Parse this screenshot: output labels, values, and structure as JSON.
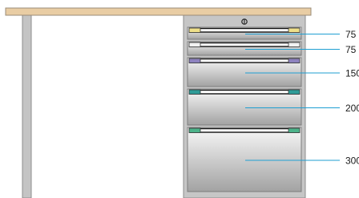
{
  "colors": {
    "worktop": "#e9cda4",
    "worktop_edge": "#9a8c78",
    "leg": "#c4c4c4",
    "leg_edge": "#8e8e8e",
    "cabinet": "#c6c6c6",
    "cabinet_edge": "#8c8c8c",
    "drawer_light": "#f8f8f8",
    "drawer_dark": "#a2a2a2",
    "leader_line": "#1f9fd2",
    "lock": "#222222"
  },
  "lock_icon": "lock-keyhole-icon",
  "drawers": [
    {
      "height_label": "75",
      "clip_color": "#efe08a",
      "clip_icon": "label-clip-icon"
    },
    {
      "height_label": "75",
      "clip_color": "#f2f2f2",
      "clip_icon": "label-clip-icon"
    },
    {
      "height_label": "150",
      "clip_color": "#8e83bf",
      "clip_icon": "label-clip-icon"
    },
    {
      "height_label": "200",
      "clip_color": "#2f9c98",
      "clip_icon": "label-clip-icon"
    },
    {
      "height_label": "300",
      "clip_color": "#4cb38a",
      "clip_icon": "label-clip-icon"
    }
  ]
}
